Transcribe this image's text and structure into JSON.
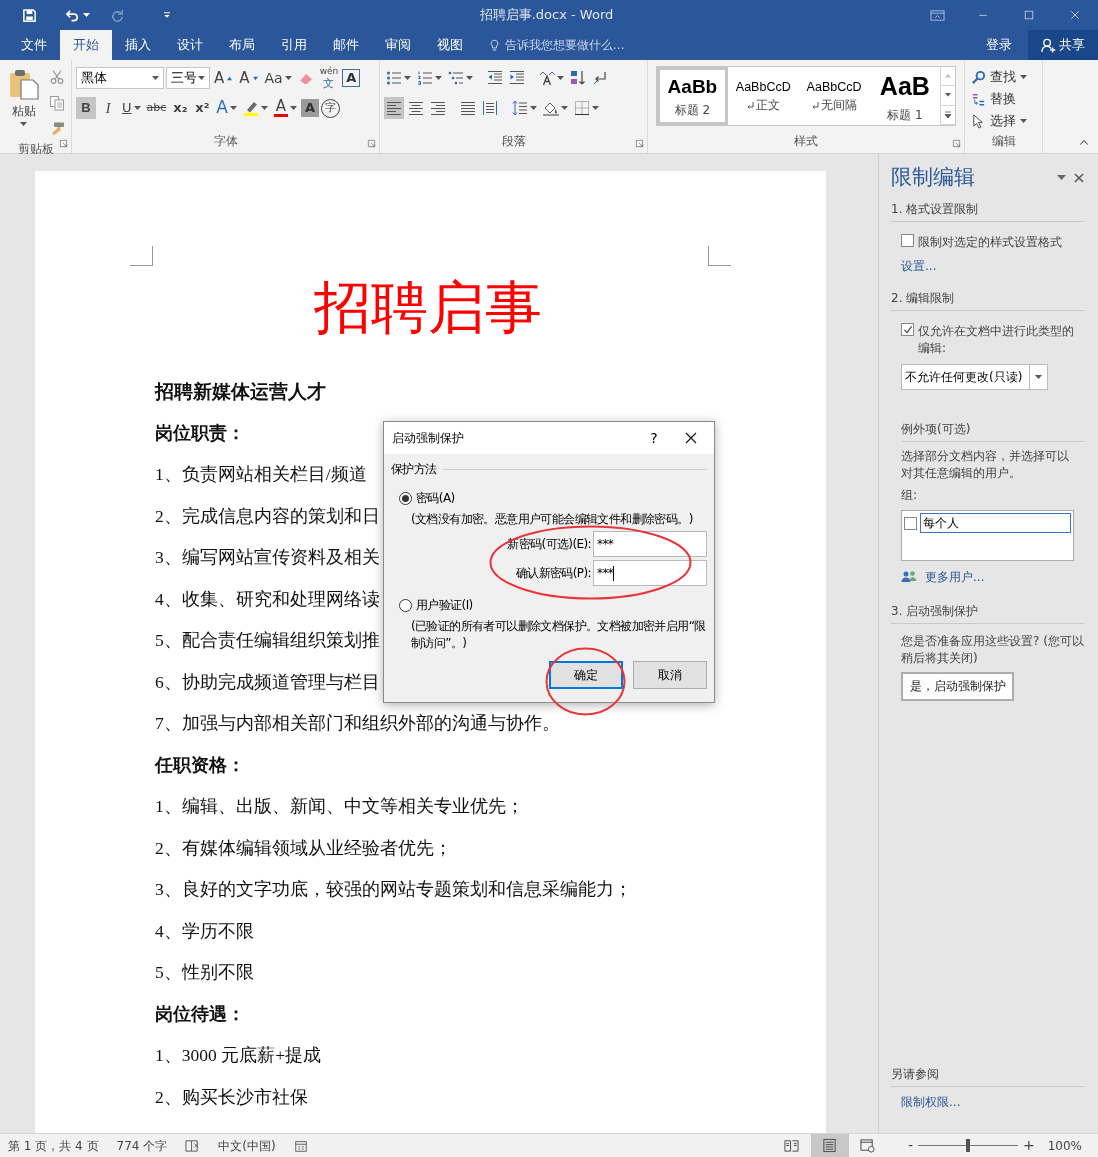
{
  "window": {
    "title": "招聘启事.docx - Word"
  },
  "tabs": [
    {
      "label": "文件",
      "selected": false
    },
    {
      "label": "开始",
      "selected": true
    },
    {
      "label": "插入",
      "selected": false
    },
    {
      "label": "设计",
      "selected": false
    },
    {
      "label": "布局",
      "selected": false
    },
    {
      "label": "引用",
      "selected": false
    },
    {
      "label": "邮件",
      "selected": false
    },
    {
      "label": "审阅",
      "selected": false
    },
    {
      "label": "视图",
      "selected": false
    }
  ],
  "tell_me": {
    "placeholder": "告诉我您想要做什么..."
  },
  "account": {
    "sign_in": "登录",
    "share": "共享"
  },
  "ribbon": {
    "clipboard": {
      "label": "剪贴板",
      "paste": "粘贴"
    },
    "font": {
      "label": "字体",
      "upper": [
        {
          "kind": "combo",
          "value": "黑体",
          "dropdown": true
        },
        {
          "kind": "combo",
          "value": "三号",
          "dropdown": true
        },
        {
          "kind": "grow",
          "text": "A"
        },
        {
          "kind": "shrink",
          "text": "A"
        },
        {
          "kind": "case",
          "text": "Aa",
          "dropdown": true
        },
        {
          "kind": "eraser"
        },
        {
          "kind": "phonetic",
          "top": "wén",
          "bottom": "文"
        },
        {
          "kind": "border",
          "text": "A"
        }
      ],
      "lower": [
        {
          "kind": "bold",
          "text": "B",
          "on": true
        },
        {
          "kind": "italic",
          "text": "I",
          "on": false
        },
        {
          "kind": "underline",
          "text": "U",
          "on": false,
          "dropdown": true
        },
        {
          "kind": "strike",
          "text": "abc",
          "on": false
        },
        {
          "kind": "sub",
          "text": "x₂",
          "on": false
        },
        {
          "kind": "sup",
          "text": "x²",
          "on": false
        },
        {
          "kind": "effects",
          "text": "A",
          "dropdown": true
        },
        {
          "kind": "highlight",
          "dropdown": true
        },
        {
          "kind": "color",
          "text": "A",
          "dropdown": true
        },
        {
          "kind": "shade",
          "text": "A"
        },
        {
          "kind": "enclose",
          "text": "字"
        }
      ]
    },
    "paragraph": {
      "label": "段落",
      "upper": [
        {
          "kind": "bullets",
          "dropdown": true
        },
        {
          "kind": "numbering",
          "dropdown": true
        },
        {
          "kind": "multilevel",
          "dropdown": true
        },
        {
          "kind": "outdent"
        },
        {
          "kind": "indent"
        },
        {
          "kind": "asian",
          "dropdown": true
        },
        {
          "kind": "sort"
        },
        {
          "kind": "marks",
          "on": false
        }
      ],
      "lower": [
        {
          "kind": "left",
          "on": true
        },
        {
          "kind": "center",
          "on": false
        },
        {
          "kind": "right",
          "on": false
        },
        {
          "kind": "justify",
          "on": false
        },
        {
          "kind": "distribute",
          "on": false
        },
        {
          "kind": "spacing",
          "dropdown": true
        },
        {
          "kind": "fill",
          "dropdown": true
        },
        {
          "kind": "borders",
          "dropdown": true
        }
      ]
    },
    "styles": {
      "label": "样式",
      "items": [
        {
          "kind": "heading2",
          "preview": "AaBb",
          "name": "标题 2",
          "paragraph_mark": false,
          "selected": true
        },
        {
          "kind": "normal",
          "preview": "AaBbCcD",
          "name": "正文",
          "paragraph_mark": true,
          "selected": false
        },
        {
          "kind": "normal",
          "preview": "AaBbCcD",
          "name": "无间隔",
          "paragraph_mark": true,
          "selected": false
        },
        {
          "kind": "heading1",
          "preview": "AaB",
          "name": "标题 1",
          "paragraph_mark": false,
          "selected": false
        }
      ]
    },
    "editing": {
      "label": "编辑",
      "items": [
        {
          "kind": "find",
          "text": "查找",
          "dropdown": true
        },
        {
          "kind": "replace",
          "text": "替换",
          "dropdown": false
        },
        {
          "kind": "select",
          "text": "选择",
          "dropdown": true
        }
      ]
    }
  },
  "document": {
    "title": "招聘启事",
    "paragraphs": [
      {
        "kind": "heading",
        "text": "招聘新媒体运营人才"
      },
      {
        "kind": "subheading",
        "text": "岗位职责："
      },
      {
        "kind": "item",
        "text": "1、负责网站相关栏目/频道"
      },
      {
        "kind": "item",
        "text": "2、完成信息内容的策划和日"
      },
      {
        "kind": "item",
        "text": "3、编写网站宣传资料及相关"
      },
      {
        "kind": "item",
        "text": "4、收集、研究和处理网络读"
      },
      {
        "kind": "item",
        "text": "5、配合责任编辑组织策划推"
      },
      {
        "kind": "item",
        "text": "6、协助完成频道管理与栏目"
      },
      {
        "kind": "item",
        "text": "7、加强与内部相关部门和组织外部的沟通与协作。"
      },
      {
        "kind": "subheading",
        "text": "任职资格："
      },
      {
        "kind": "item",
        "text": "1、编辑、出版、新闻、中文等相关专业优先；"
      },
      {
        "kind": "item",
        "text": "2、有媒体编辑领域从业经验者优先；"
      },
      {
        "kind": "item",
        "text": "3、良好的文字功底，较强的网站专题策划和信息采编能力；"
      },
      {
        "kind": "item",
        "text": "4、学历不限"
      },
      {
        "kind": "item",
        "text": "5、性别不限"
      },
      {
        "kind": "subheading",
        "text": "岗位待遇："
      },
      {
        "kind": "item",
        "text": "1、3000 元底薪+提成"
      },
      {
        "kind": "item",
        "text": "2、购买长沙市社保"
      }
    ]
  },
  "dialog": {
    "title": "启动强制保护",
    "help": "?",
    "group": "保护方法",
    "methods": [
      {
        "label": "密码(A)",
        "selected": true,
        "note": "(文档没有加密。恶意用户可能会编辑文件和删除密码。)",
        "fields": [
          {
            "label": "新密码(可选)(E):",
            "value": "***",
            "focused": false
          },
          {
            "label": "确认新密码(P):",
            "value": "***",
            "focused": true
          }
        ]
      },
      {
        "label": "用户验证(I)",
        "selected": false,
        "note": "(已验证的所有者可以删除文档保护。文档被加密并启用“限制访问”。)"
      }
    ],
    "buttons": [
      {
        "label": "确定",
        "default": true
      },
      {
        "label": "取消",
        "default": false
      }
    ]
  },
  "pane": {
    "title": "限制编辑",
    "format_section": {
      "heading": "1. 格式设置限制",
      "option": {
        "label": "限制对选定的样式设置格式",
        "checked": false
      },
      "link": "设置..."
    },
    "editing_section": {
      "heading": "2. 编辑限制",
      "option": {
        "label": "仅允许在文档中进行此类型的编辑:",
        "checked": true
      },
      "select": "不允许任何更改(只读)",
      "exceptions_heading": "例外项(可选)",
      "exceptions_text": "选择部分文档内容，并选择可以对其任意编辑的用户。",
      "group_label": "组:",
      "groups": [
        {
          "name": "每个人",
          "checked": false
        }
      ],
      "more_users": "更多用户..."
    },
    "enforce_section": {
      "heading": "3. 启动强制保护",
      "text": "您是否准备应用这些设置? (您可以稍后将其关闭)",
      "button": "是，启动强制保护"
    },
    "see_also": {
      "heading": "另请参阅",
      "link": "限制权限..."
    }
  },
  "status_bar": {
    "page": "第 1 页，共 4 页",
    "words": "774 个字",
    "language": "中文(中国)",
    "views": [
      {
        "kind": "read",
        "selected": false
      },
      {
        "kind": "print",
        "selected": true
      },
      {
        "kind": "web",
        "selected": false
      }
    ],
    "zoom_out": "-",
    "zoom_in": "+",
    "zoom": {
      "level": 0.5,
      "reading": "100%"
    }
  }
}
